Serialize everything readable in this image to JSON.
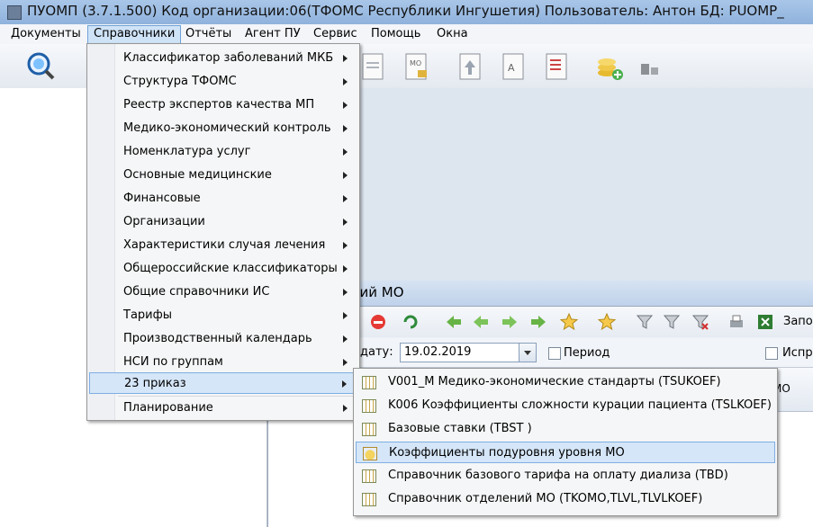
{
  "window": {
    "title": "ПУОМП (3.7.1.500)  Код организации:06(ТФОМС Республики Ингушетия)  Пользователь: Антон БД: PUOMP_"
  },
  "menubar": [
    "Документы",
    "Справочники",
    "Отчёты",
    "Агент ПУ",
    "Сервис",
    "Помощь",
    "Окна"
  ],
  "spravochniki_menu": [
    {
      "label": "Классификатор заболеваний МКБ"
    },
    {
      "label": "Структура ТФОМС"
    },
    {
      "label": "Реестр экспертов качества МП"
    },
    {
      "label": "Медико-экономический контроль"
    },
    {
      "label": "Номенклатура услуг"
    },
    {
      "label": "Основные медицинские"
    },
    {
      "label": "Финансовые"
    },
    {
      "label": "Организации"
    },
    {
      "label": "Характеристики случая лечения"
    },
    {
      "label": "Общероссийские классификаторы"
    },
    {
      "label": "Общие справочники ИС"
    },
    {
      "label": "Тарифы"
    },
    {
      "label": "Производственный календарь"
    },
    {
      "label": "НСИ по группам"
    },
    {
      "label": "23 приказ"
    },
    {
      "label": "Планирование"
    }
  ],
  "submenu_23": [
    {
      "label": "V001_М Медико-экономические стандарты (TSUKOEF)"
    },
    {
      "label": "K006 Коэффициенты сложности курации пациента (TSLKOEF)"
    },
    {
      "label": "Базовые ставки (TBST )"
    },
    {
      "label": "Коэффициенты подуровня уровня МО"
    },
    {
      "label": "Справочник базового тарифа на оплату диализа (TBD)"
    },
    {
      "label": "Справочник отделений МО (TKOMO,TLVL,TLVLKOEF)"
    }
  ],
  "child_window": {
    "title": "ник отделений МО",
    "toolbar_tail": "Запол",
    "date_label": "дату:",
    "date_value": "19.02.2019",
    "period_label": "Период",
    "ispr_label": "Испра",
    "grid_header": "МО"
  },
  "colors": {
    "highlight": "#d5e6f8",
    "highlight_border": "#7eaee3"
  }
}
